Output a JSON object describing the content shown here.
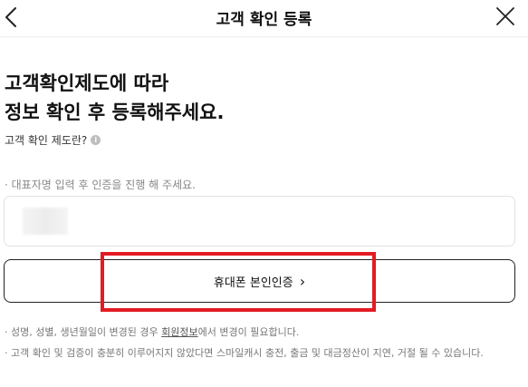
{
  "header": {
    "title": "고객 확인 등록",
    "back_icon": "chevron-left-icon",
    "close_icon": "close-icon"
  },
  "main": {
    "headline_line1": "고객확인제도에 따라",
    "headline_line2": "정보 확인 후 등록해주세요.",
    "info_link_label": "고객 확인 제도란?",
    "info_icon": "info-icon",
    "name_hint": "· 대표자명 입력 후 인증을 진행 해 주세요.",
    "verify_button_label": "휴대폰 본인인증",
    "verify_button_arrow": "›"
  },
  "notes": {
    "note1_before": "· 성명, 성별, 생년월일이 변경된 경우 ",
    "note1_link": "회원정보",
    "note1_after": "에서 변경이 필요합니다.",
    "note2": "· 고객 확인 및 검증이 충분히 이루어지지 않았다면 스마일캐시 충전, 출금 및 대금정산이 지연, 거절 될 수 있습니다."
  },
  "colors": {
    "highlight": "#e31b23",
    "button_border": "#222222"
  }
}
